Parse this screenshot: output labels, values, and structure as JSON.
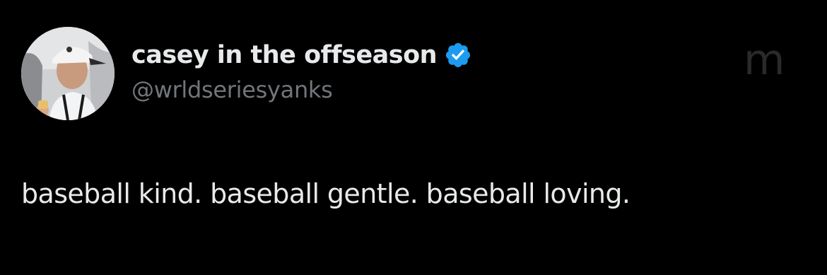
{
  "tweet": {
    "author": {
      "display_name": "casey in the offseason",
      "handle": "@wrldseriesyanks",
      "verified": true,
      "avatar": "profile-photo"
    },
    "text": "baseball kind. baseball gentle. baseball loving.",
    "watermark_text": "m"
  },
  "colors": {
    "background": "#000000",
    "primary_text": "#e7e9ea",
    "secondary_text": "#71767b",
    "verified_badge": "#1d9bf0"
  },
  "icons": {
    "verified": "verified-badge-icon"
  }
}
